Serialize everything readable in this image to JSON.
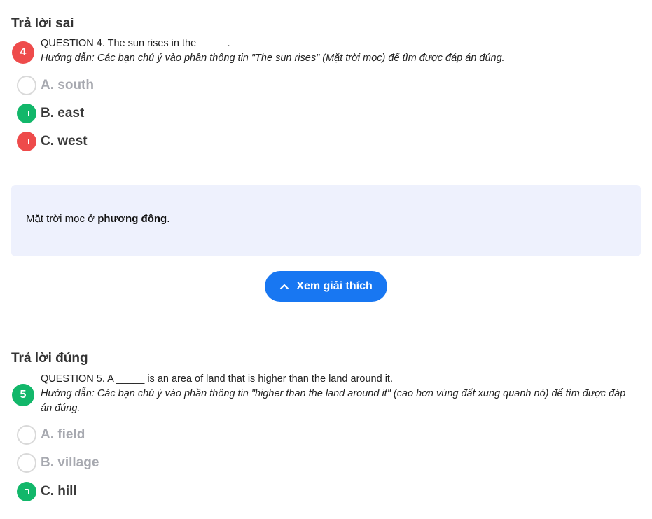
{
  "questions": [
    {
      "status": "Trả lời sai",
      "number": "4",
      "text": "QUESTION 4. The sun rises in the _____.",
      "guide": "Hướng dẫn: Các bạn chú ý vào phần thông tin \"The sun rises\" (Mặt trời mọc) để tìm được đáp án đúng.",
      "options": [
        {
          "label": "A. south",
          "state": "unselected"
        },
        {
          "label": "B. east",
          "state": "correct"
        },
        {
          "label": "C. west",
          "state": "wrong"
        }
      ],
      "explanation": {
        "prefix": "Mặt trời mọc ở ",
        "bold": "phương đông",
        "suffix": "."
      },
      "explain_button": "Xem giải thích"
    },
    {
      "status": "Trả lời đúng",
      "number": "5",
      "text": "QUESTION 5. A _____ is an area of land that is higher than the land around it.",
      "guide": "Hướng dẫn: Các bạn chú ý vào phần thông tin \"higher than the land around it\" (cao hơn vùng đất xung quanh nó) để tìm được đáp án đúng.",
      "options": [
        {
          "label": "A. field",
          "state": "unselected"
        },
        {
          "label": "B. village",
          "state": "unselected"
        },
        {
          "label": "C. hill",
          "state": "correct"
        }
      ]
    }
  ],
  "icons": {
    "button": "chevron-up-icon",
    "option_marker": "placeholder-glyph-icon"
  },
  "colors": {
    "correct": "#12b76a",
    "wrong": "#ee4b4b",
    "primary": "#1877f2",
    "explanation_bg": "#eef1fd"
  }
}
